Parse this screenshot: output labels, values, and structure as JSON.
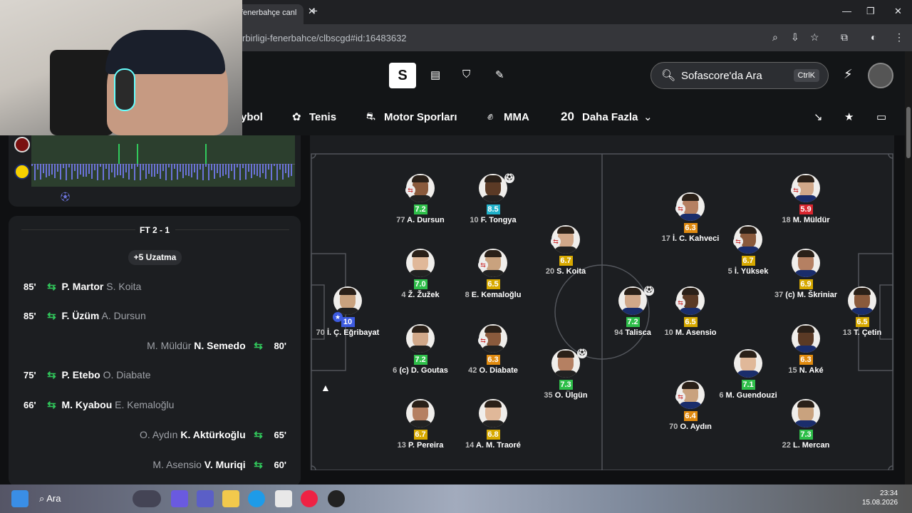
{
  "browser": {
    "tab_title": "fenerbahçe canl",
    "url": "rbirligi-fenerbahce/clbscgd#id:16483632"
  },
  "header": {
    "logo": "S",
    "search_placeholder": "Sofascore'da Ara",
    "search_kbd": "CtrlK"
  },
  "sports_nav": {
    "partial": "ybol",
    "tennis": "Tenis",
    "motor": "Motor Sporları",
    "mma": "MMA",
    "more_count": "20",
    "more": "Daha Fazla"
  },
  "events_panel": {
    "result": "FT 2 - 1",
    "extra_time": "+5 Uzatma",
    "events": [
      {
        "minute": "85'",
        "side": "left",
        "in": "P. Martor",
        "out": "S. Koita"
      },
      {
        "minute": "85'",
        "side": "left",
        "in": "F. Üzüm",
        "out": "A. Dursun"
      },
      {
        "minute": "80'",
        "side": "right",
        "in": "N. Semedo",
        "out": "M. Müldür"
      },
      {
        "minute": "75'",
        "side": "left",
        "in": "P. Etebo",
        "out": "O. Diabate"
      },
      {
        "minute": "66'",
        "side": "left",
        "in": "M. Kyabou",
        "out": "E. Kemaloğlu"
      },
      {
        "minute": "65'",
        "side": "right",
        "in": "K. Aktürkoğlu",
        "out": "O. Aydın"
      },
      {
        "minute": "60'",
        "side": "right",
        "in": "V. Muriqi",
        "out": "M. Asensio"
      }
    ]
  },
  "lineup": {
    "home": [
      {
        "num": "70",
        "name": "İ. Ç. Eğribayat",
        "rating": "10",
        "color": "#3d5be0",
        "sub": false,
        "goal": false,
        "star": true
      },
      {
        "num": "77",
        "name": "A. Dursun",
        "rating": "7.2",
        "color": "#2fbf4a",
        "sub": true,
        "goal": false
      },
      {
        "num": "4",
        "name": "Ž. Žužek",
        "rating": "7.0",
        "color": "#2fbf4a",
        "sub": false,
        "goal": false
      },
      {
        "num": "6",
        "name": "(c) D. Goutas",
        "rating": "7.2",
        "color": "#2fbf4a",
        "sub": false,
        "goal": false
      },
      {
        "num": "13",
        "name": "P. Pereira",
        "rating": "6.7",
        "color": "#d7a900",
        "sub": false,
        "goal": false
      },
      {
        "num": "10",
        "name": "F. Tongya",
        "rating": "8.5",
        "color": "#20b1c9",
        "sub": false,
        "goal": true
      },
      {
        "num": "8",
        "name": "E. Kemaloğlu",
        "rating": "6.5",
        "color": "#d7a900",
        "sub": true,
        "goal": false
      },
      {
        "num": "42",
        "name": "O. Diabate",
        "rating": "6.3",
        "color": "#e08a0f",
        "sub": true,
        "goal": false
      },
      {
        "num": "14",
        "name": "A. M. Traoré",
        "rating": "6.8",
        "color": "#d7a900",
        "sub": false,
        "goal": false
      },
      {
        "num": "20",
        "name": "S. Koita",
        "rating": "6.7",
        "color": "#d7a900",
        "sub": true,
        "goal": false
      },
      {
        "num": "35",
        "name": "O. Ülgün",
        "rating": "7.3",
        "color": "#2fbf4a",
        "sub": false,
        "goal": true
      }
    ],
    "away": [
      {
        "num": "94",
        "name": "Talisca",
        "rating": "7.2",
        "color": "#2fbf4a",
        "sub": false,
        "goal": true
      },
      {
        "num": "17",
        "name": "İ. C. Kahveci",
        "rating": "6.3",
        "color": "#e08a0f",
        "sub": true,
        "goal": false
      },
      {
        "num": "10",
        "name": "M. Asensio",
        "rating": "6.5",
        "color": "#d7a900",
        "sub": true,
        "goal": false
      },
      {
        "num": "70",
        "name": "O. Aydın",
        "rating": "6.4",
        "color": "#e08a0f",
        "sub": true,
        "goal": false
      },
      {
        "num": "5",
        "name": "İ. Yüksek",
        "rating": "6.7",
        "color": "#d7a900",
        "sub": true,
        "goal": false
      },
      {
        "num": "6",
        "name": "M. Guendouzi",
        "rating": "7.1",
        "color": "#2fbf4a",
        "sub": false,
        "goal": false
      },
      {
        "num": "18",
        "name": "M. Müldür",
        "rating": "5.9",
        "color": "#d8262f",
        "sub": true,
        "goal": false
      },
      {
        "num": "37",
        "name": "(c) M. Škriniar",
        "rating": "6.9",
        "color": "#d7a900",
        "sub": false,
        "goal": false
      },
      {
        "num": "15",
        "name": "N. Aké",
        "rating": "6.3",
        "color": "#e08a0f",
        "sub": false,
        "goal": false
      },
      {
        "num": "22",
        "name": "L. Mercan",
        "rating": "7.3",
        "color": "#2fbf4a",
        "sub": false,
        "goal": false
      },
      {
        "num": "13",
        "name": "T. Çetin",
        "rating": "6.5",
        "color": "#d7a900",
        "sub": false,
        "goal": false
      }
    ]
  },
  "taskbar": {
    "search": "Ara",
    "time": "23:34",
    "date": "15.08.2026"
  }
}
